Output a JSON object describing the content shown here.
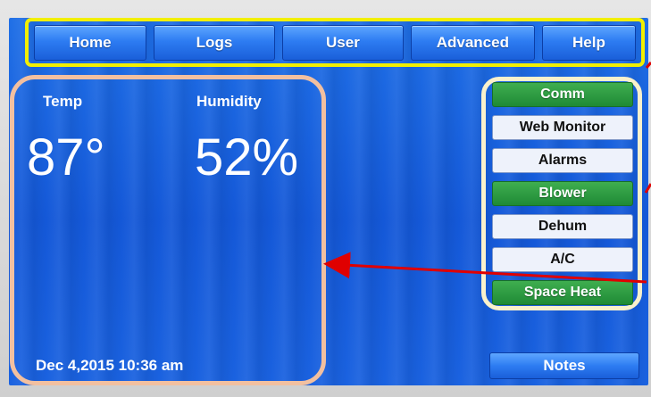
{
  "nav": {
    "items": [
      {
        "label": "Home"
      },
      {
        "label": "Logs"
      },
      {
        "label": "User"
      },
      {
        "label": "Advanced"
      },
      {
        "label": "Help"
      }
    ]
  },
  "readout": {
    "temp_label": "Temp",
    "temp_value": "87°",
    "humidity_label": "Humidity",
    "humidity_value": "52%",
    "datetime": "Dec 4,2015  10:36 am"
  },
  "side_menu": {
    "items": [
      {
        "label": "Comm",
        "style": "green"
      },
      {
        "label": "Web Monitor",
        "style": "white"
      },
      {
        "label": "Alarms",
        "style": "white"
      },
      {
        "label": "Blower",
        "style": "green"
      },
      {
        "label": "Dehum",
        "style": "white"
      },
      {
        "label": "A/C",
        "style": "white"
      },
      {
        "label": "Space Heat",
        "style": "green"
      }
    ]
  },
  "notes_label": "Notes",
  "colors": {
    "screen_blue": "#1458d8",
    "nav_highlight": "#f2ef00",
    "readout_highlight": "#f2c0a0",
    "side_highlight": "#faf1cc",
    "arrow": "#e00000",
    "green_button": "#1f8a36"
  }
}
